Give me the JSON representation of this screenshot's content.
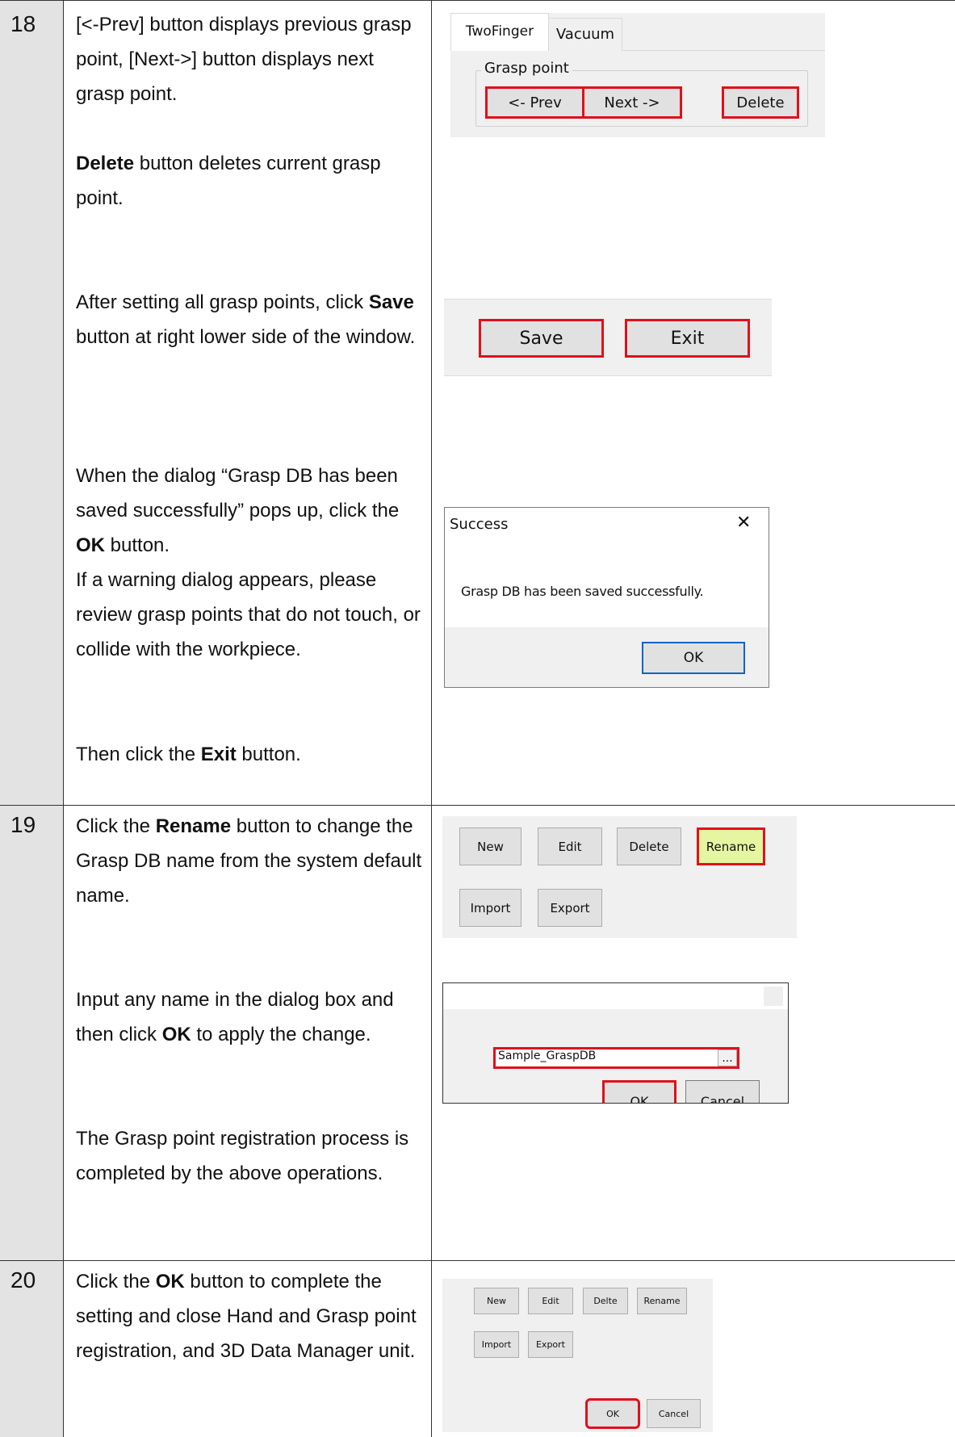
{
  "steps": [
    {
      "number": "18",
      "paragraphs": [
        {
          "id": "p1",
          "parts": [
            {
              "t": "[<-Prev] button displays previous grasp point, [Next->] button displays next grasp point."
            }
          ]
        },
        {
          "id": "p2",
          "parts": [
            {
              "t": "Delete",
              "b": true
            },
            {
              "t": " button deletes current grasp point."
            }
          ]
        },
        {
          "id": "p3",
          "parts": [
            {
              "t": "After setting all grasp points, click "
            },
            {
              "t": "Save",
              "b": true
            },
            {
              "t": " button at right lower side of the window."
            }
          ]
        },
        {
          "id": "p4",
          "parts": [
            {
              "t": "When the dialog “Grasp DB has been saved successfully” pops up, click the "
            },
            {
              "t": "OK",
              "b": true
            },
            {
              "t": " button."
            }
          ]
        },
        {
          "id": "p5",
          "parts": [
            {
              "t": "If a warning dialog appears, please review grasp points that do not touch, or collide with the workpiece."
            }
          ]
        },
        {
          "id": "p6",
          "parts": [
            {
              "t": "Then click the "
            },
            {
              "t": "Exit",
              "b": true
            },
            {
              "t": " button."
            }
          ]
        }
      ]
    },
    {
      "number": "19",
      "paragraphs": [
        {
          "id": "p7",
          "parts": [
            {
              "t": "Click the "
            },
            {
              "t": "Rename",
              "b": true
            },
            {
              "t": " button to change the Grasp DB name from the system default name."
            }
          ]
        },
        {
          "id": "p8",
          "parts": [
            {
              "t": "Input any name in the dialog box and then click "
            },
            {
              "t": "OK",
              "b": true
            },
            {
              "t": " to apply the change."
            }
          ]
        },
        {
          "id": "p9",
          "parts": [
            {
              "t": "The Grasp point registration process is completed by the above operations."
            }
          ]
        }
      ]
    },
    {
      "number": "20",
      "paragraphs": [
        {
          "id": "p10",
          "parts": [
            {
              "t": "Click the "
            },
            {
              "t": "OK",
              "b": true
            },
            {
              "t": " button to complete the setting and close Hand and Grasp point registration, and 3D Data Manager unit."
            }
          ]
        }
      ]
    }
  ],
  "shot_grasp": {
    "tab_twofinger": "TwoFinger",
    "tab_vacuum": "Vacuum",
    "group_label": "Grasp point",
    "prev_label": "<- Prev",
    "next_label": "Next ->",
    "delete_label": "Delete"
  },
  "shot_save": {
    "save_label": "Save",
    "exit_label": "Exit"
  },
  "shot_success": {
    "title": "Success",
    "close_glyph": "✕",
    "message": "Grasp DB has been saved successfully.",
    "ok_label": "OK"
  },
  "shot_db_buttons": {
    "new_label": "New",
    "edit_label": "Edit",
    "delete_label": "Delete",
    "rename_label": "Rename",
    "import_label": "Import",
    "export_label": "Export"
  },
  "shot_rename": {
    "name_value": "Sample_GraspDB",
    "browse_label": "...",
    "ok_label": "OK",
    "cancel_label": "Cancel"
  },
  "shot_final": {
    "new_label": "New",
    "edit_label": "Edit",
    "delete_label": "Delte",
    "rename_label": "Rename",
    "import_label": "Import",
    "export_label": "Export",
    "ok_label": "OK",
    "cancel_label": "Cancel"
  }
}
